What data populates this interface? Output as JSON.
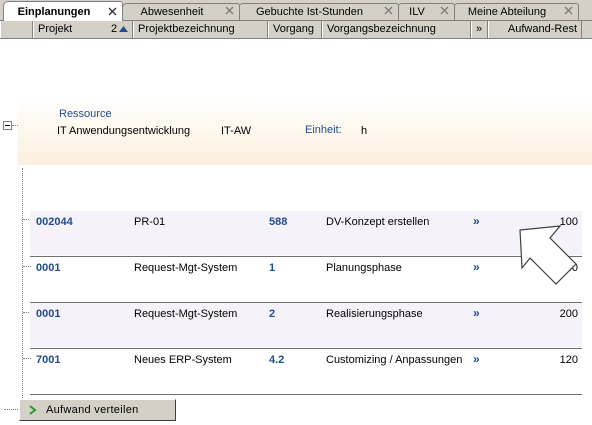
{
  "tabs": [
    {
      "label": "Einplanungen",
      "active": true
    },
    {
      "label": "Abwesenheit"
    },
    {
      "label": "Gebuchte Ist-Stunden"
    },
    {
      "label": "ILV"
    },
    {
      "label": "Meine Abteilung"
    }
  ],
  "columns": {
    "projekt": "Projekt",
    "sort_index": "2",
    "projektbezeichnung": "Projektbezeichnung",
    "vorgang": "Vorgang",
    "vorgangsbezeichnung": "Vorgangsbezeichnung",
    "more": "»",
    "aufwand_rest": "Aufwand-Rest"
  },
  "resource": {
    "heading": "Ressource",
    "name": "IT Anwendungsentwicklung",
    "code": "IT-AW",
    "unit_label": "Einheit:",
    "unit_value": "h"
  },
  "rows": [
    {
      "projekt": "002044",
      "projektbezeichnung": "PR-01",
      "vorgang": "588",
      "vorgangsbezeichnung": "DV-Konzept erstellen",
      "more": "»",
      "aufwand_rest": "100"
    },
    {
      "projekt": "0001",
      "projektbezeichnung": "Request-Mgt-System",
      "vorgang": "1",
      "vorgangsbezeichnung": "Planungsphase",
      "more": "»",
      "aufwand_rest": "40"
    },
    {
      "projekt": "0001",
      "projektbezeichnung": "Request-Mgt-System",
      "vorgang": "2",
      "vorgangsbezeichnung": "Realisierungsphase",
      "more": "»",
      "aufwand_rest": "200"
    },
    {
      "projekt": "7001",
      "projektbezeichnung": "Neues ERP-System",
      "vorgang": "4.2",
      "vorgangsbezeichnung": "Customizing / Anpassungen",
      "more": "»",
      "aufwand_rest": "120"
    }
  ],
  "footer": {
    "distribute_button": "Aufwand verteilen"
  },
  "colors": {
    "link": "#1f4e8c",
    "resource_bg": "#fbefe0",
    "row_alt": "#f6f2fa",
    "chrome": "#d4d0c8"
  },
  "icons": [
    "close-tab-icon",
    "sort-ascending-icon",
    "tree-collapse-icon",
    "green-arrow-icon",
    "big-pointer-arrow-icon"
  ]
}
